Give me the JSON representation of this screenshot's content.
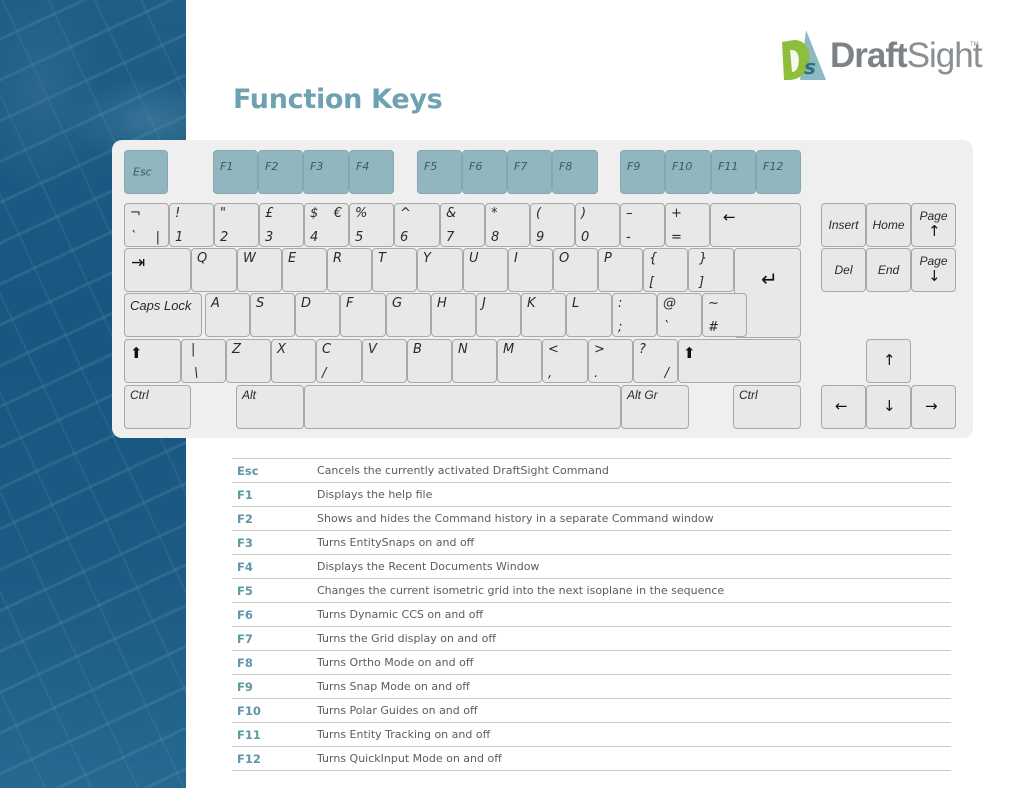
{
  "page": {
    "title": "Function Keys",
    "logo": {
      "brand_bold": "Draft",
      "brand_light": "Sight",
      "trademark": "TM",
      "icon": "draftsight-logo-icon"
    }
  },
  "keyboard": {
    "esc": "Esc",
    "fkeys": [
      "F1",
      "F2",
      "F3",
      "F4",
      "F5",
      "F6",
      "F7",
      "F8",
      "F9",
      "F10",
      "F11",
      "F12"
    ],
    "number_row": [
      {
        "top": "¬",
        "bottom": "`",
        "br": "|"
      },
      {
        "top": "!",
        "bottom": "1"
      },
      {
        "top": "\"",
        "bottom": "2"
      },
      {
        "top": "£",
        "bottom": "3"
      },
      {
        "top": "$",
        "tr": "€",
        "bottom": "4"
      },
      {
        "top": "%",
        "bottom": "5"
      },
      {
        "top": "^",
        "bottom": "6"
      },
      {
        "top": "&",
        "bottom": "7"
      },
      {
        "top": "*",
        "bottom": "8"
      },
      {
        "top": "(",
        "bottom": "9"
      },
      {
        "top": ")",
        "bottom": "0"
      },
      {
        "top": "–",
        "bottom": "-"
      },
      {
        "top": "+",
        "bottom": "="
      }
    ],
    "backspace_icon": "←",
    "tab_icon": "⇥",
    "qwerty_row": [
      "Q",
      "W",
      "E",
      "R",
      "T",
      "Y",
      "U",
      "I",
      "O",
      "P"
    ],
    "brackets": [
      {
        "top": "{",
        "bottom": "["
      },
      {
        "top": "}",
        "bottom": "]"
      }
    ],
    "enter_icon": "↵",
    "caps_lock": "Caps Lock",
    "home_row": [
      "A",
      "S",
      "D",
      "F",
      "G",
      "H",
      "J",
      "K",
      "L"
    ],
    "home_extra": [
      {
        "top": ":",
        "bottom": ";"
      },
      {
        "top": "@",
        "bottom": "`"
      },
      {
        "top": "~",
        "bottom": "#"
      }
    ],
    "shift_icon": "⬆",
    "backslash": {
      "top": "|",
      "bottom": "\\"
    },
    "bottom_row": [
      "Z",
      "X"
    ],
    "c_key": {
      "top": "C",
      "bottom": "/"
    },
    "bottom_row2": [
      "V",
      "B",
      "N",
      "M"
    ],
    "punct": [
      {
        "top": "<",
        "bottom": ","
      },
      {
        "top": ">",
        "bottom": "."
      },
      {
        "top": "?",
        "br": "/"
      }
    ],
    "ctrl": "Ctrl",
    "alt": "Alt",
    "alt_gr": "Alt Gr",
    "nav": {
      "insert": "Insert",
      "home": "Home",
      "page_up": "Page",
      "page_up_arrow": "↑",
      "del": "Del",
      "end": "End",
      "page_down": "Page",
      "page_down_arrow": "↓"
    },
    "arrows": {
      "up": "↑",
      "down": "↓",
      "left": "←",
      "right": "→"
    }
  },
  "shortcuts": [
    {
      "key": "Esc",
      "desc": "Cancels the currently activated DraftSight Command"
    },
    {
      "key": "F1",
      "desc": "Displays the help file"
    },
    {
      "key": "F2",
      "desc": "Shows and hides the Command history in a separate Command window"
    },
    {
      "key": "F3",
      "desc": "Turns EntitySnaps on and off"
    },
    {
      "key": "F4",
      "desc": "Displays the Recent Documents Window"
    },
    {
      "key": "F5",
      "desc": "Changes the current isometric grid into the next isoplane in the sequence"
    },
    {
      "key": "F6",
      "desc": "Turns Dynamic CCS on and off"
    },
    {
      "key": "F7",
      "desc": "Turns the Grid display on and off"
    },
    {
      "key": "F8",
      "desc": "Turns Ortho Mode on and off"
    },
    {
      "key": "F9",
      "desc": "Turns Snap Mode on and off"
    },
    {
      "key": "F10",
      "desc": "Turns Polar Guides on and off"
    },
    {
      "key": "F11",
      "desc": "Turns Entity Tracking on and off"
    },
    {
      "key": "F12",
      "desc": "Turns QuickInput Mode on and off"
    }
  ],
  "colors": {
    "accent": "#6fa2b1",
    "fn_key": "#92b6c0",
    "sidebar": "#1b5a82"
  }
}
